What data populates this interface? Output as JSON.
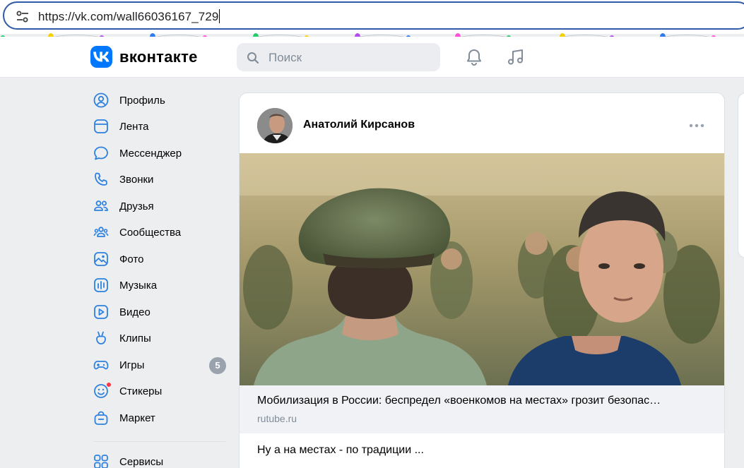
{
  "browser": {
    "url": "https://vk.com/wall66036167_729"
  },
  "garland": {
    "colors": [
      "#22cc66",
      "#f5d000",
      "#b44af0",
      "#2f7bf0",
      "#ff4fd8"
    ]
  },
  "header": {
    "brand": "вконтакте",
    "search_placeholder": "Поиск",
    "icons": [
      "bell-icon",
      "music-icon"
    ]
  },
  "sidebar": {
    "items": [
      {
        "label": "Профиль",
        "icon": "profile-icon"
      },
      {
        "label": "Лента",
        "icon": "feed-icon"
      },
      {
        "label": "Мессенджер",
        "icon": "messenger-icon"
      },
      {
        "label": "Звонки",
        "icon": "phone-icon"
      },
      {
        "label": "Друзья",
        "icon": "friends-icon"
      },
      {
        "label": "Сообщества",
        "icon": "communities-icon"
      },
      {
        "label": "Фото",
        "icon": "photo-icon"
      },
      {
        "label": "Музыка",
        "icon": "music-icon"
      },
      {
        "label": "Видео",
        "icon": "video-icon"
      },
      {
        "label": "Клипы",
        "icon": "clips-icon"
      },
      {
        "label": "Игры",
        "icon": "games-icon",
        "badge": "5"
      },
      {
        "label": "Стикеры",
        "icon": "stickers-icon"
      },
      {
        "label": "Маркет",
        "icon": "market-icon"
      },
      {
        "label": "Сервисы",
        "icon": "services-icon"
      }
    ]
  },
  "post": {
    "author": "Анатолий Кирсанов",
    "link_title": "Мобилизация в России: беспредел «военкомов на местах» грозит безопас…",
    "link_domain": "rutube.ru",
    "text": "Ну а на местах - по традиции ..."
  }
}
